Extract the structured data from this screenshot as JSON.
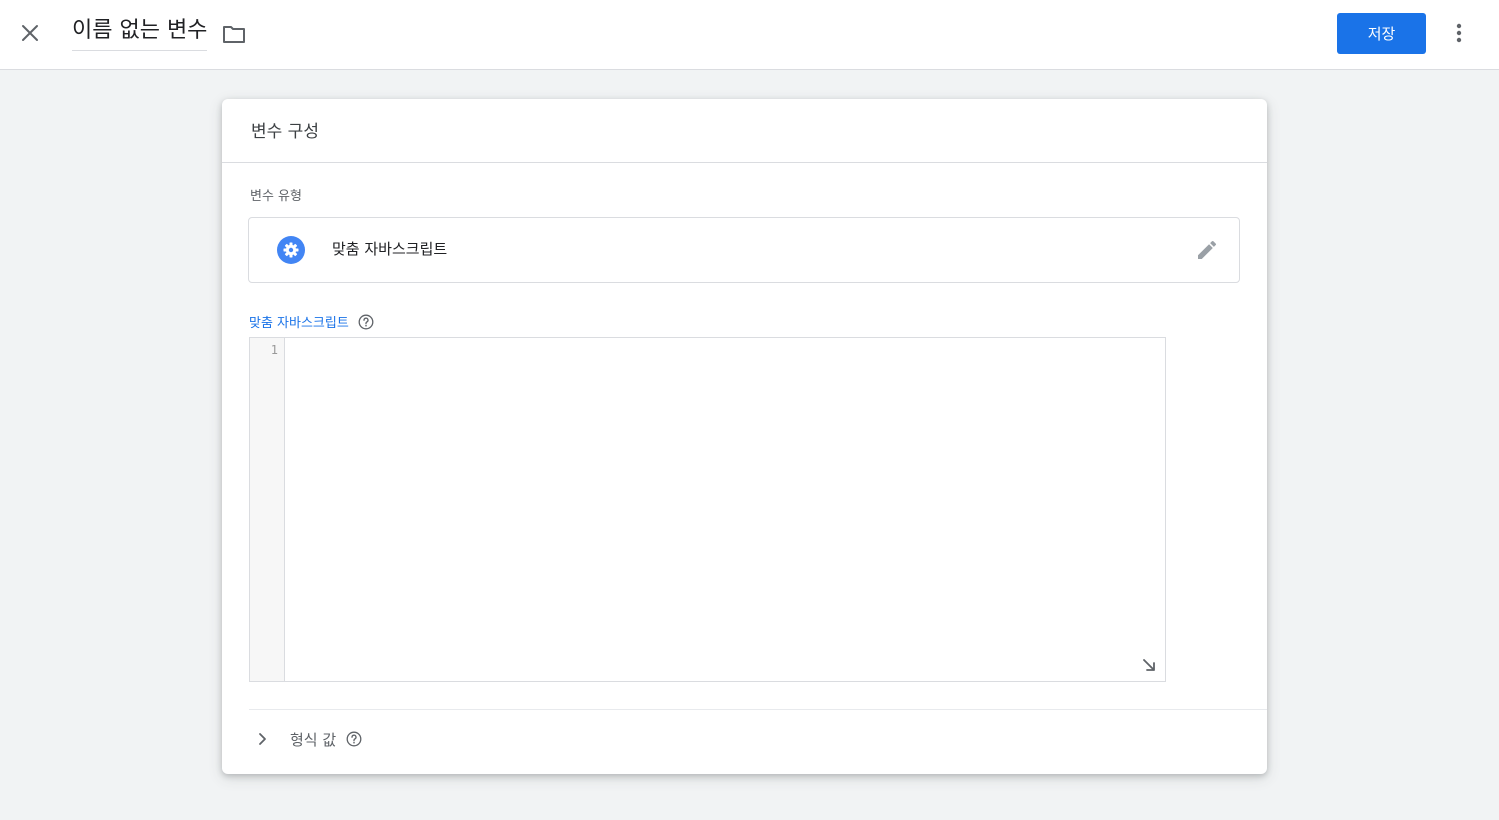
{
  "header": {
    "title": "이름 없는 변수",
    "save_label": "저장"
  },
  "card": {
    "title": "변수 구성",
    "type_label": "변수 유형",
    "type_name": "맞춤 자바스크립트",
    "code_label": "맞춤 자바스크립트",
    "line_number": "1",
    "format_label": "형식 값"
  },
  "icons": {
    "close": "close-icon",
    "folder": "folder-icon",
    "more": "more-vert-icon",
    "type": "settings-gear-icon",
    "edit": "pencil-icon",
    "help": "help-circle-icon",
    "resize": "resize-arrow-icon",
    "expand": "chevron-right-icon"
  },
  "colors": {
    "accent": "#1a73e8",
    "background": "#f1f3f4",
    "border": "#dadce0"
  }
}
